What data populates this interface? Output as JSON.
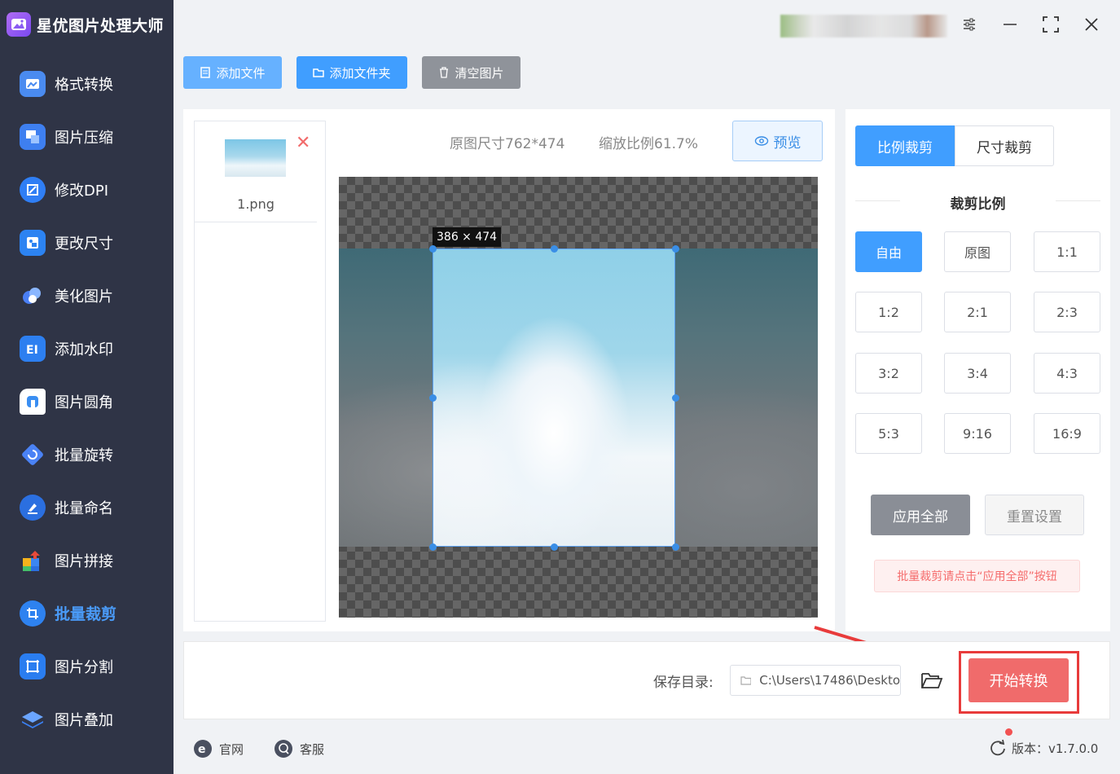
{
  "app": {
    "title": "星优图片处理大师"
  },
  "sidebar": {
    "items": [
      {
        "label": "格式转换",
        "icon": "format-convert-icon",
        "active": false
      },
      {
        "label": "图片压缩",
        "icon": "image-compress-icon",
        "active": false
      },
      {
        "label": "修改DPI",
        "icon": "dpi-icon",
        "active": false
      },
      {
        "label": "更改尺寸",
        "icon": "resize-icon",
        "active": false
      },
      {
        "label": "美化图片",
        "icon": "beautify-icon",
        "active": false
      },
      {
        "label": "添加水印",
        "icon": "watermark-icon",
        "active": false
      },
      {
        "label": "图片圆角",
        "icon": "rounded-corner-icon",
        "active": false
      },
      {
        "label": "批量旋转",
        "icon": "rotate-icon",
        "active": false
      },
      {
        "label": "批量命名",
        "icon": "rename-icon",
        "active": false
      },
      {
        "label": "图片拼接",
        "icon": "puzzle-icon",
        "active": false
      },
      {
        "label": "批量裁剪",
        "icon": "crop-icon",
        "active": true
      },
      {
        "label": "图片分割",
        "icon": "split-icon",
        "active": false
      },
      {
        "label": "图片叠加",
        "icon": "layers-icon",
        "active": false
      }
    ]
  },
  "toolbar": {
    "add_file": "添加文件",
    "add_folder": "添加文件夹",
    "clear": "清空图片"
  },
  "file_list": {
    "items": [
      {
        "name": "1.png"
      }
    ]
  },
  "preview": {
    "original_size": "原图尺寸762*474",
    "scale": "缩放比例61.7%",
    "preview_label": "预览",
    "crop_dims": "386 × 474"
  },
  "crop_panel": {
    "tab_ratio": "比例裁剪",
    "tab_size": "尺寸裁剪",
    "section_title": "裁剪比例",
    "ratios": [
      "自由",
      "原图",
      "1:1",
      "1:2",
      "2:1",
      "2:3",
      "3:2",
      "3:4",
      "4:3",
      "5:3",
      "9:16",
      "16:9"
    ],
    "selected": "自由",
    "apply_all": "应用全部",
    "reset": "重置设置",
    "tip": "批量裁剪请点击“应用全部”按钮"
  },
  "output": {
    "save_label": "保存目录:",
    "save_path": "C:\\Users\\17486\\Deskto",
    "start": "开始转换"
  },
  "footer": {
    "website": "官网",
    "service": "客服",
    "version": "版本：v1.7.0.0"
  },
  "colors": {
    "accent": "#409eff",
    "sidebar_bg": "#2f3446",
    "start": "#f06b6b",
    "highlight": "#e83b3b"
  }
}
